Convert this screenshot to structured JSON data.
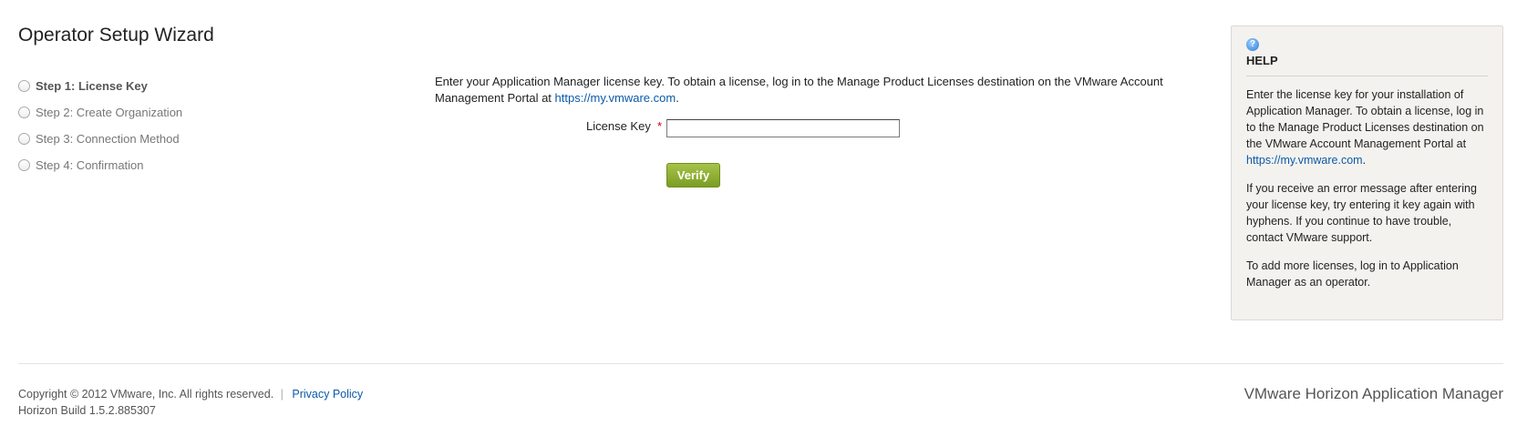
{
  "wizard": {
    "title": "Operator Setup Wizard",
    "steps": [
      {
        "label": "Step 1: License Key",
        "active": true
      },
      {
        "label": "Step 2: Create Organization",
        "active": false
      },
      {
        "label": "Step 3: Connection Method",
        "active": false
      },
      {
        "label": "Step 4: Confirmation",
        "active": false
      }
    ]
  },
  "main": {
    "intro_text": "Enter your Application Manager license key. To obtain a license, log in to the Manage Product Licenses destination on the VMware Account Management Portal at",
    "intro_link": "https://my.vmware.com",
    "intro_end": ".",
    "license_key_label": "License Key",
    "required_marker": "*",
    "license_key_value": "",
    "verify_label": "Verify"
  },
  "help": {
    "icon": "help-question-icon",
    "icon_glyph": "?",
    "title": "HELP",
    "p1_text": "Enter the license key for your installation of Application Manager. To obtain a license, log in to the Manage Product Licenses destination on the VMware Account Management Portal at",
    "p1_link": "https://my.vmware.com",
    "p1_end": ".",
    "p2_text": "If you receive an error message after entering your license key, try entering it key again with hyphens. If you continue to have trouble, contact VMware support.",
    "p3_text": "To add more licenses, log in to Application Manager as an operator."
  },
  "footer": {
    "copyright": "Copyright © 2012 VMware, Inc. All rights reserved.",
    "separator": "|",
    "privacy_link": "Privacy Policy",
    "build": "Horizon Build 1.5.2.885307",
    "brand": "VMware Horizon Application Manager"
  },
  "colors": {
    "link": "#0b5aa8",
    "verify_button": "#8fb034",
    "required": "#cc0000",
    "help_panel_bg": "#f4f2ee"
  }
}
